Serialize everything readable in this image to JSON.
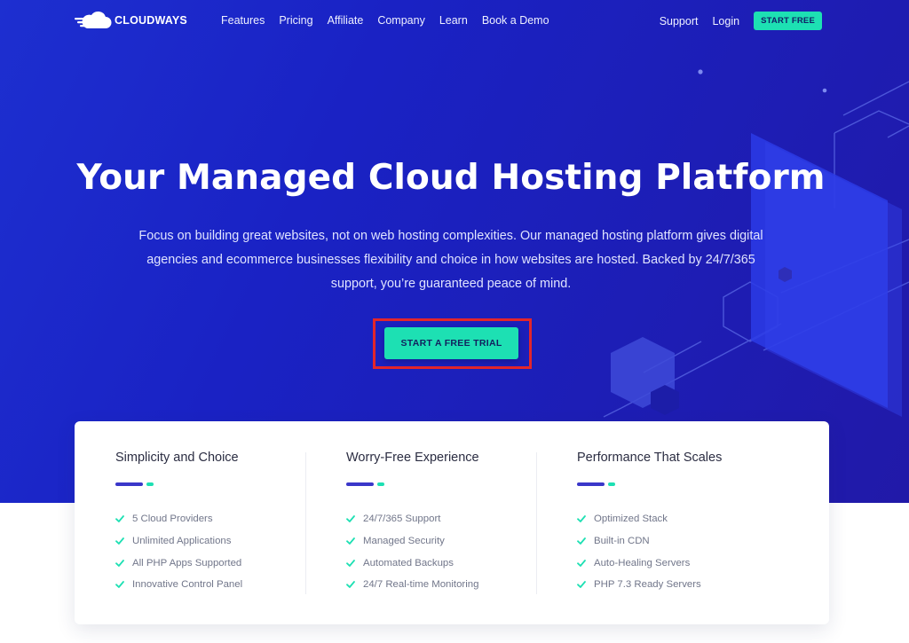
{
  "brand": {
    "name": "CLOUDWAYS",
    "logo_icon": "cloudways-logo-icon"
  },
  "nav": {
    "links": [
      "Features",
      "Pricing",
      "Affiliate",
      "Company",
      "Learn",
      "Book a Demo"
    ],
    "support": "Support",
    "login": "Login",
    "start_free": "START FREE"
  },
  "hero": {
    "title": "Your Managed Cloud Hosting Platform",
    "subtitle": "Focus on building great websites, not on web hosting complexities. Our managed hosting platform gives digital agencies and ecommerce businesses flexibility and choice in how websites are hosted. Backed by 24/7/365 support, you’re guaranteed peace of mind.",
    "cta": "START A FREE TRIAL"
  },
  "features": [
    {
      "title": "Simplicity and Choice",
      "items": [
        "5 Cloud Providers",
        "Unlimited Applications",
        "All PHP Apps Supported",
        "Innovative Control Panel"
      ]
    },
    {
      "title": "Worry-Free Experience",
      "items": [
        "24/7/365 Support",
        "Managed Security",
        "Automated Backups",
        "24/7 Real-time Monitoring"
      ]
    },
    {
      "title": "Performance That Scales",
      "items": [
        "Optimized Stack",
        "Built-in CDN",
        "Auto-Healing Servers",
        "PHP 7.3 Ready Servers"
      ]
    }
  ],
  "colors": {
    "hero_bg": "#1c22c4",
    "accent_green": "#1de0b3",
    "accent_indigo": "#3a37c9",
    "highlight_red": "#e3262b"
  },
  "icons": {
    "check": "check-icon"
  }
}
